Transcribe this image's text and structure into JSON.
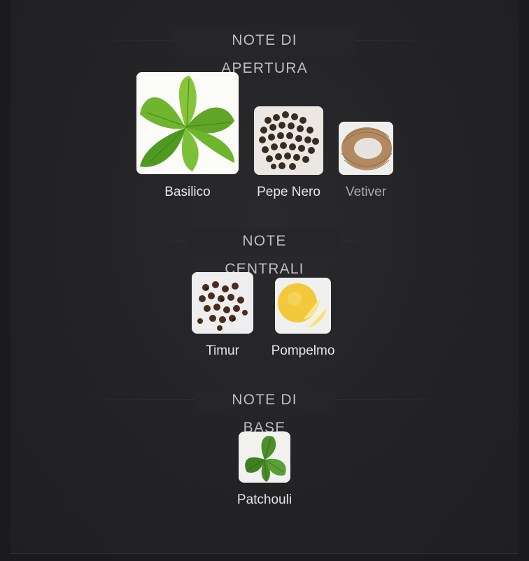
{
  "sections": [
    {
      "title": "NOTE DI APERTURA",
      "notes": [
        {
          "label": "Basilico",
          "icon": "basil-leaves-image"
        },
        {
          "label": "Pepe Nero",
          "icon": "black-pepper-image"
        },
        {
          "label": "Vetiver",
          "icon": "vetiver-roots-image"
        }
      ]
    },
    {
      "title": "NOTE CENTRALI",
      "notes": [
        {
          "label": "Timur",
          "icon": "timur-pepper-image"
        },
        {
          "label": "Pompelmo",
          "icon": "grapefruit-image"
        }
      ]
    },
    {
      "title": "NOTE DI BASE",
      "notes": [
        {
          "label": "Patchouli",
          "icon": "patchouli-leaves-image"
        }
      ]
    }
  ],
  "colors": {
    "background": "#1b1b1d",
    "card": "#252528",
    "heading": "#bdbdc2",
    "label": "#e6e6ea"
  }
}
